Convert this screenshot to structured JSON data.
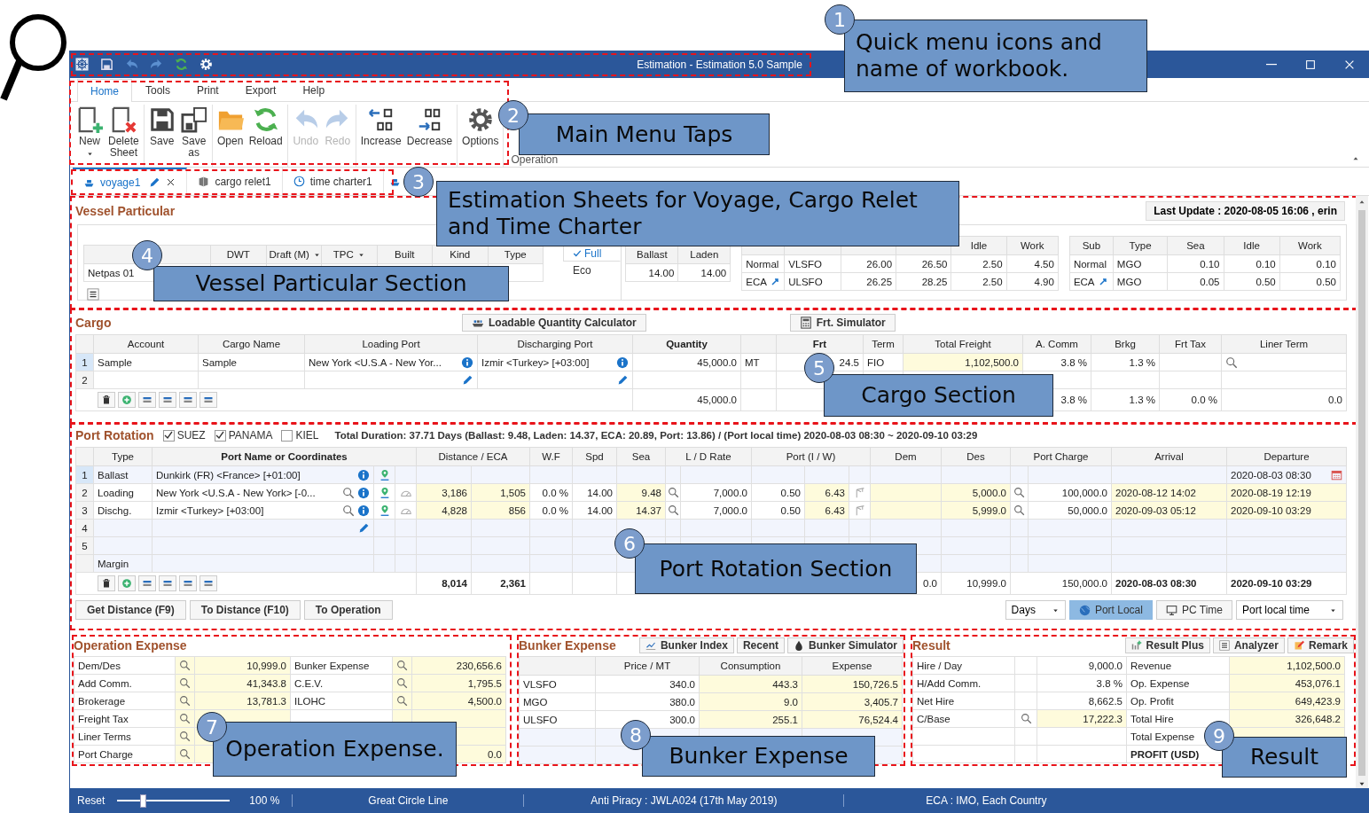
{
  "window": {
    "title": "Estimation - Estimation 5.0 Sample"
  },
  "menu_tabs": [
    {
      "label": "Home",
      "selected": true
    },
    {
      "label": "Tools",
      "selected": false
    },
    {
      "label": "Print",
      "selected": false
    },
    {
      "label": "Export",
      "selected": false
    },
    {
      "label": "Help",
      "selected": false
    }
  ],
  "ribbon": {
    "groups": [
      [
        {
          "label": "New",
          "dropdown": true,
          "disabled": false
        },
        {
          "label": "Delete Sheet",
          "dropdown": false,
          "disabled": false
        }
      ],
      [
        {
          "label": "Save",
          "dropdown": false,
          "disabled": false
        },
        {
          "label": "Save as",
          "dropdown": false,
          "disabled": false
        }
      ],
      [
        {
          "label": "Open",
          "dropdown": false,
          "disabled": false
        },
        {
          "label": "Reload",
          "dropdown": false,
          "disabled": false
        }
      ],
      [
        {
          "label": "Undo",
          "dropdown": false,
          "disabled": true
        },
        {
          "label": "Redo",
          "dropdown": false,
          "disabled": true
        }
      ],
      [
        {
          "label": "Increase",
          "dropdown": false,
          "disabled": false
        },
        {
          "label": "Decrease",
          "dropdown": false,
          "disabled": false
        }
      ],
      [
        {
          "label": "Options",
          "dropdown": false,
          "disabled": false
        }
      ]
    ],
    "group_label": "Operation"
  },
  "sheet_tabs": [
    {
      "label": "voyage1",
      "kind": "voyage",
      "selected": true
    },
    {
      "label": "cargo relet1",
      "kind": "cargo",
      "selected": false
    },
    {
      "label": "time charter1",
      "kind": "time",
      "selected": false
    }
  ],
  "vessel": {
    "title": "Vessel Particular",
    "last_update": "Last Update : 2020-08-05 16:06 , erin",
    "columns": [
      {
        "label": "DWT",
        "dropdown": false
      },
      {
        "label": "Draft (M)",
        "dropdown": true
      },
      {
        "label": "TPC",
        "dropdown": true
      },
      {
        "label": "Built",
        "dropdown": false
      },
      {
        "label": "Kind",
        "dropdown": false
      },
      {
        "label": "Type",
        "dropdown": false
      }
    ],
    "name": "Netpas 01",
    "speed_modes": [
      {
        "label": "Full",
        "selected": true
      },
      {
        "label": "Eco",
        "selected": false
      }
    ],
    "speed": {
      "columns": [
        "Ballast",
        "Laden"
      ],
      "values": [
        "14.00",
        "14.00"
      ]
    },
    "main_engine": {
      "visible_columns": [
        "Idle",
        "Work"
      ],
      "rows": [
        {
          "kind": "normal",
          "cells": [
            "Normal",
            "VLSFO",
            "26.00",
            "26.50",
            "2.50",
            "4.50"
          ]
        },
        {
          "kind": "eca",
          "cells": [
            "ECA",
            "ULSFO",
            "26.25",
            "28.25",
            "2.50",
            "4.90"
          ]
        }
      ]
    },
    "sub_engine": {
      "columns": [
        "Sub",
        "Type",
        "Sea",
        "Idle",
        "Work"
      ],
      "rows": [
        {
          "kind": "normal",
          "cells": [
            "Normal",
            "MGO",
            "0.10",
            "0.10",
            "0.10"
          ]
        },
        {
          "kind": "eca",
          "cells": [
            "ECA",
            "MGO",
            "0.05",
            "0.50",
            "0.50"
          ]
        }
      ]
    }
  },
  "cargo": {
    "title": "Cargo",
    "buttons": [
      "Loadable Quantity Calculator",
      "Frt. Simulator"
    ],
    "columns": [
      "Account",
      "Cargo Name",
      "Loading Port",
      "Discharging Port",
      "Quantity",
      "Frt",
      "Term",
      "Total Freight",
      "A. Comm",
      "Brkg",
      "Frt Tax",
      "Liner Term"
    ],
    "rows": [
      {
        "num": "1",
        "kind": "filled",
        "account": "Sample",
        "cargo_name": "Sample",
        "loading_port": "New York <U.S.A - New Yor...",
        "discharging_port": "Izmir <Turkey> [+03:00]",
        "quantity": "45,000.0",
        "unit": "MT",
        "frt": "24.5",
        "term": "FIO",
        "total_freight": "1,102,500.0",
        "a_comm": "3.8 %",
        "brkg": "1.3 %"
      },
      {
        "num": "2",
        "kind": "edit"
      }
    ],
    "totals": {
      "quantity": "45,000.0",
      "a_comm": "3.8 %",
      "brkg": "1.3 %",
      "frt_tax": "0.0 %",
      "liner_term": "0.0"
    }
  },
  "port_rotation": {
    "title": "Port Rotation",
    "routes": [
      {
        "label": "SUEZ",
        "checked": true
      },
      {
        "label": "PANAMA",
        "checked": true
      },
      {
        "label": "KIEL",
        "checked": false
      }
    ],
    "duration": "Total Duration: 37.71 Days (Ballast: 9.48, Laden: 14.37, ECA: 20.89, Port: 13.86) / (Port local time) 2020-08-03 08:30 ~ 2020-09-10 03:29",
    "columns": [
      "Type",
      "Port Name or Coordinates",
      "Distance / ECA",
      "W.F",
      "Spd",
      "Sea",
      "L / D Rate",
      "Port (I / W)",
      "Dem",
      "Des",
      "Port Charge",
      "Arrival",
      "Departure"
    ],
    "rows": [
      {
        "num": "1",
        "kind": "start",
        "type": "Ballast",
        "port": "Dunkirk (FR) <France> [+01:00]",
        "departure": "2020-08-03 08:30"
      },
      {
        "num": "2",
        "kind": "port",
        "type": "Loading",
        "port": "New York <U.S.A - New York> [-0...",
        "distance": "3,186",
        "eca": "1,505",
        "wf": "0.0 %",
        "spd": "14.00",
        "sea": "9.48",
        "ld_rate": "7,000.0",
        "port_i": "0.50",
        "port_w": "6.43",
        "des": "5,000.0",
        "port_charge": "100,000.0",
        "arrival": "2020-08-12 14:02",
        "departure": "2020-08-19 12:19"
      },
      {
        "num": "3",
        "kind": "port",
        "type": "Dischg.",
        "port": "Izmir <Turkey> [+03:00]",
        "distance": "4,828",
        "eca": "856",
        "wf": "0.0 %",
        "spd": "14.00",
        "sea": "14.37",
        "ld_rate": "7,000.0",
        "port_i": "0.50",
        "port_w": "6.43",
        "des": "5,999.0",
        "port_charge": "50,000.0",
        "arrival": "2020-09-03 05:12",
        "departure": "2020-09-10 03:29"
      },
      {
        "num": "4",
        "kind": "edit"
      },
      {
        "num": "5",
        "kind": "blank"
      },
      {
        "kind": "margin",
        "type": "Margin"
      }
    ],
    "totals": {
      "distance": "8,014",
      "eca": "2,361",
      "dem": "0.0",
      "des": "10,999.0",
      "port_charge": "150,000.0",
      "arrival": "2020-08-03 08:30",
      "departure": "2020-09-10 03:29"
    },
    "buttons": [
      "Get Distance (F9)",
      "To Distance (F10)",
      "To Operation"
    ],
    "time_controls": {
      "unit": "Days",
      "modes": [
        {
          "label": "Port Local",
          "selected": true
        },
        {
          "label": "PC Time",
          "selected": false
        }
      ],
      "zone": "Port local time"
    }
  },
  "operation_expense": {
    "title": "Operation Expense",
    "rows": [
      {
        "label": "Dem/Des",
        "value": "10,999.0",
        "label_2": "Bunker Expense",
        "value_2": "230,656.6"
      },
      {
        "label": "Add Comm.",
        "value": "41,343.8",
        "label_2": "C.E.V.",
        "value_2": "1,795.5"
      },
      {
        "label": "Brokerage",
        "value": "13,781.3",
        "label_2": "ILOHC",
        "value_2": "4,500.0"
      },
      {
        "label": "Freight Tax"
      },
      {
        "label": "Liner Terms"
      },
      {
        "label": "Port Charge",
        "value_2": "0.0"
      }
    ]
  },
  "bunker_expense": {
    "title": "Bunker Expense",
    "buttons": [
      "Bunker Index",
      "Recent",
      "Bunker Simulator"
    ],
    "columns": [
      "Price / MT",
      "Consumption",
      "Expense"
    ],
    "rows": [
      {
        "fuel": "VLSFO",
        "cells": [
          "340.0",
          "443.3",
          "150,726.5"
        ]
      },
      {
        "fuel": "MGO",
        "cells": [
          "380.0",
          "9.0",
          "3,405.7"
        ]
      },
      {
        "fuel": "ULSFO",
        "cells": [
          "300.0",
          "255.1",
          "76,524.4"
        ]
      }
    ]
  },
  "result": {
    "title": "Result",
    "buttons": [
      "Result Plus",
      "Analyzer",
      "Remark"
    ],
    "rows": [
      {
        "kind": "plain",
        "label": "Hire / Day",
        "value": "9,000.0",
        "label_2": "Revenue",
        "value_2": "1,102,500.0"
      },
      {
        "kind": "plain",
        "label": "H/Add Comm.",
        "value": "3.8 %",
        "label_2": "Op. Expense",
        "value_2": "453,076.1"
      },
      {
        "kind": "plain",
        "label": "Net Hire",
        "value": "8,662.5",
        "label_2": "Op. Profit",
        "value_2": "649,423.9"
      },
      {
        "kind": "lookup",
        "label": "C/Base",
        "value": "17,222.3",
        "label_2": "Total Hire",
        "value_2": "326,648.2"
      },
      {
        "kind": "plain",
        "label_2": "Total Expense"
      },
      {
        "kind": "total",
        "label_2": "PROFIT (USD)"
      }
    ]
  },
  "status_bar": {
    "reset": "Reset",
    "zoom": {
      "level": 0.2,
      "reading": "100 %"
    },
    "items": [
      "Great Circle Line",
      "Anti Piracy : JWLA024 (17th May 2019)",
      "ECA : IMO, Each Country"
    ]
  },
  "callouts": [
    {
      "number": "1",
      "text": "Quick menu icons and name of workbook."
    },
    {
      "number": "2",
      "text": "Main Menu Taps"
    },
    {
      "number": "3",
      "text": "Estimation Sheets for Voyage, Cargo Relet and Time Charter"
    },
    {
      "number": "4",
      "text": "Vessel Particular Section"
    },
    {
      "number": "5",
      "text": "Cargo Section"
    },
    {
      "number": "6",
      "text": "Port Rotation Section"
    },
    {
      "number": "7",
      "text": "Operation Expense."
    },
    {
      "number": "8",
      "text": "Bunker Expense"
    },
    {
      "number": "9",
      "text": "Result"
    }
  ]
}
